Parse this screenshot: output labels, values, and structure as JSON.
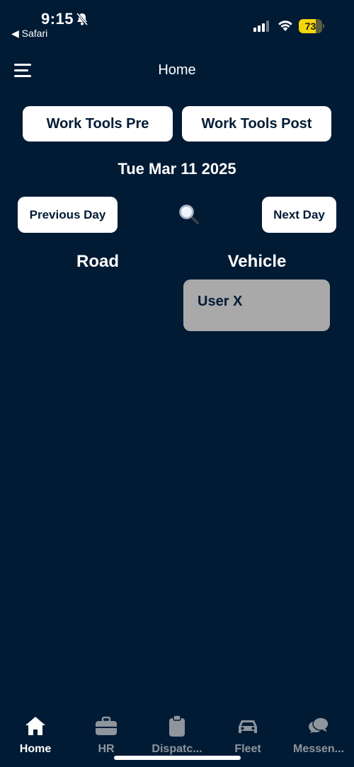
{
  "status_bar": {
    "time": "9:15",
    "back_app": "◀ Safari",
    "battery_level": "73",
    "battery_fraction": 0.73,
    "icons": [
      "bell-slash-icon",
      "cellular-signal-icon",
      "wifi-icon",
      "battery-icon"
    ]
  },
  "header": {
    "title": "Home",
    "menu_icon": "hamburger-menu-icon"
  },
  "work_tools": {
    "pre_label": "Work Tools Pre",
    "post_label": "Work Tools Post"
  },
  "date": {
    "label": "Tue Mar 11 2025",
    "previous_label": "Previous Day",
    "next_label": "Next Day",
    "search_icon": "magnifying-glass-icon"
  },
  "columns": {
    "road": {
      "header": "Road",
      "items": []
    },
    "vehicle": {
      "header": "Vehicle",
      "items": [
        {
          "name": "User X"
        }
      ]
    }
  },
  "tabs": [
    {
      "label": "Home",
      "icon": "home-icon",
      "active": true
    },
    {
      "label": "HR",
      "icon": "briefcase-icon",
      "active": false
    },
    {
      "label": "Dispatc...",
      "icon": "clipboard-icon",
      "active": false
    },
    {
      "label": "Fleet",
      "icon": "car-icon",
      "active": false
    },
    {
      "label": "Messen...",
      "icon": "chat-bubbles-icon",
      "active": false
    }
  ],
  "colors": {
    "background": "#011b35",
    "button_bg": "#ffffff",
    "button_text": "#011b35",
    "card_bg": "#a9a9a9",
    "tab_inactive": "#8f959c",
    "battery": "#f5d60e"
  }
}
